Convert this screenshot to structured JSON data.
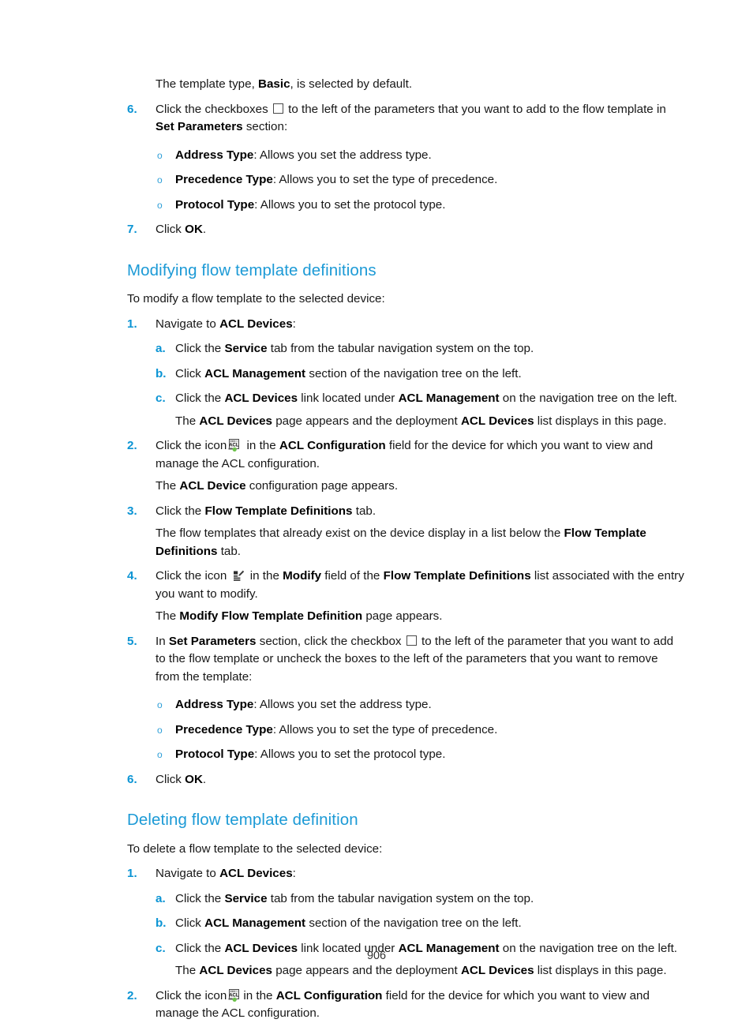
{
  "page": {
    "folio": "906"
  },
  "top_section": {
    "intro": {
      "pre": "The template type, ",
      "bold": "Basic",
      "post": ", is selected by default."
    },
    "step6": {
      "marker": "6.",
      "t1": "Click the checkboxes ",
      "checkbox_icon": "checkbox-icon",
      "t2": " to the left of the parameters that you want to add to the flow template in ",
      "b1": "Set Parameters",
      "t3": " section:"
    },
    "bullets": [
      {
        "marker": "o",
        "bold": "Address Type",
        "text": ": Allows you set the address type."
      },
      {
        "marker": "o",
        "bold": "Precedence Type",
        "text": ": Allows you to set the type of precedence."
      },
      {
        "marker": "o",
        "bold": "Protocol Type",
        "text": ": Allows you to set the protocol type."
      }
    ],
    "step7": {
      "marker": "7.",
      "t1": "Click ",
      "b1": "OK",
      "t2": "."
    }
  },
  "modifying": {
    "heading": "Modifying flow template definitions",
    "lead": "To modify a flow template to the selected device:",
    "step1": {
      "marker": "1.",
      "t1": "Navigate to ",
      "b1": "ACL Devices",
      "t2": ":"
    },
    "sub_a": {
      "marker": "a.",
      "t1": "Click the ",
      "b1": "Service",
      "t2": " tab from the tabular navigation system on the top."
    },
    "sub_b": {
      "marker": "b.",
      "t1": "Click ",
      "b1": "ACL Management",
      "t2": " section of the navigation tree on the left."
    },
    "sub_c": {
      "marker": "c.",
      "t1": "Click the ",
      "b1": "ACL Devices",
      "t2": " link located under ",
      "b2": "ACL Management",
      "t3": " on the navigation tree on the left."
    },
    "sub_c_result": {
      "t1": "The ",
      "b1": "ACL Devices",
      "t2": " page appears and the deployment ",
      "b2": "ACL Devices",
      "t3": " list displays in this page."
    },
    "step2": {
      "marker": "2.",
      "t1": "Click the icon",
      "icon": "acl-config-icon",
      "t2": " in the ",
      "b1": "ACL Configuration",
      "t3": " field for the device for which you want to view and manage the ACL configuration."
    },
    "step2_result": {
      "t1": "The ",
      "b1": "ACL Device",
      "t2": " configuration page appears."
    },
    "step3": {
      "marker": "3.",
      "t1": "Click the ",
      "b1": "Flow Template Definitions",
      "t2": " tab."
    },
    "step3_result": {
      "t1": "The flow templates that already exist on the device display in a list below the ",
      "b1": "Flow Template Definitions",
      "t2": " tab."
    },
    "step4": {
      "marker": "4.",
      "t1": "Click the icon ",
      "icon": "modify-icon",
      "t2": " in the ",
      "b1": "Modify",
      "t3": " field of the ",
      "b2": "Flow Template Definitions",
      "t4": " list associated with the entry you want to modify."
    },
    "step4_result": {
      "t1": "The ",
      "b1": "Modify Flow Template Definition",
      "t2": " page appears."
    },
    "step5": {
      "marker": "5.",
      "t1": "In ",
      "b1": "Set Parameters",
      "t2": " section, click the checkbox ",
      "checkbox_icon": "checkbox-icon",
      "t3": " to the left of the parameter that you want to add to the flow template or uncheck the boxes to the left of the parameters that you want to remove from the template:"
    },
    "bullets": [
      {
        "marker": "o",
        "bold": "Address Type",
        "text": ": Allows you set the address type."
      },
      {
        "marker": "o",
        "bold": "Precedence Type",
        "text": ": Allows you to set the type of precedence."
      },
      {
        "marker": "o",
        "bold": "Protocol Type",
        "text": ": Allows you to set the protocol type."
      }
    ],
    "step6": {
      "marker": "6.",
      "t1": "Click ",
      "b1": "OK",
      "t2": "."
    }
  },
  "deleting": {
    "heading": "Deleting flow template definition",
    "lead": "To delete a flow template to the selected device:",
    "step1": {
      "marker": "1.",
      "t1": "Navigate to ",
      "b1": "ACL Devices",
      "t2": ":"
    },
    "sub_a": {
      "marker": "a.",
      "t1": "Click the ",
      "b1": "Service",
      "t2": " tab from the tabular navigation system on the top."
    },
    "sub_b": {
      "marker": "b.",
      "t1": "Click ",
      "b1": "ACL Management",
      "t2": " section of the navigation tree on the left."
    },
    "sub_c": {
      "marker": "c.",
      "t1": "Click the ",
      "b1": "ACL Devices",
      "t2": " link located under ",
      "b2": "ACL Management",
      "t3": " on the navigation tree on the left."
    },
    "sub_c_result": {
      "t1": "The ",
      "b1": "ACL Devices",
      "t2": " page appears and the deployment ",
      "b2": "ACL Devices",
      "t3": " list displays in this page."
    },
    "step2": {
      "marker": "2.",
      "t1": "Click the icon",
      "icon": "acl-config-icon",
      "t2": "in the ",
      "b1": "ACL Configuration",
      "t3": " field for the device for which you want to view and manage the ACL configuration."
    }
  },
  "colors": {
    "heading_blue": "#1c9ad6",
    "marker_blue": "#0b94d4",
    "bullet_blue": "#2f9fd8",
    "body_text": "#171717"
  }
}
